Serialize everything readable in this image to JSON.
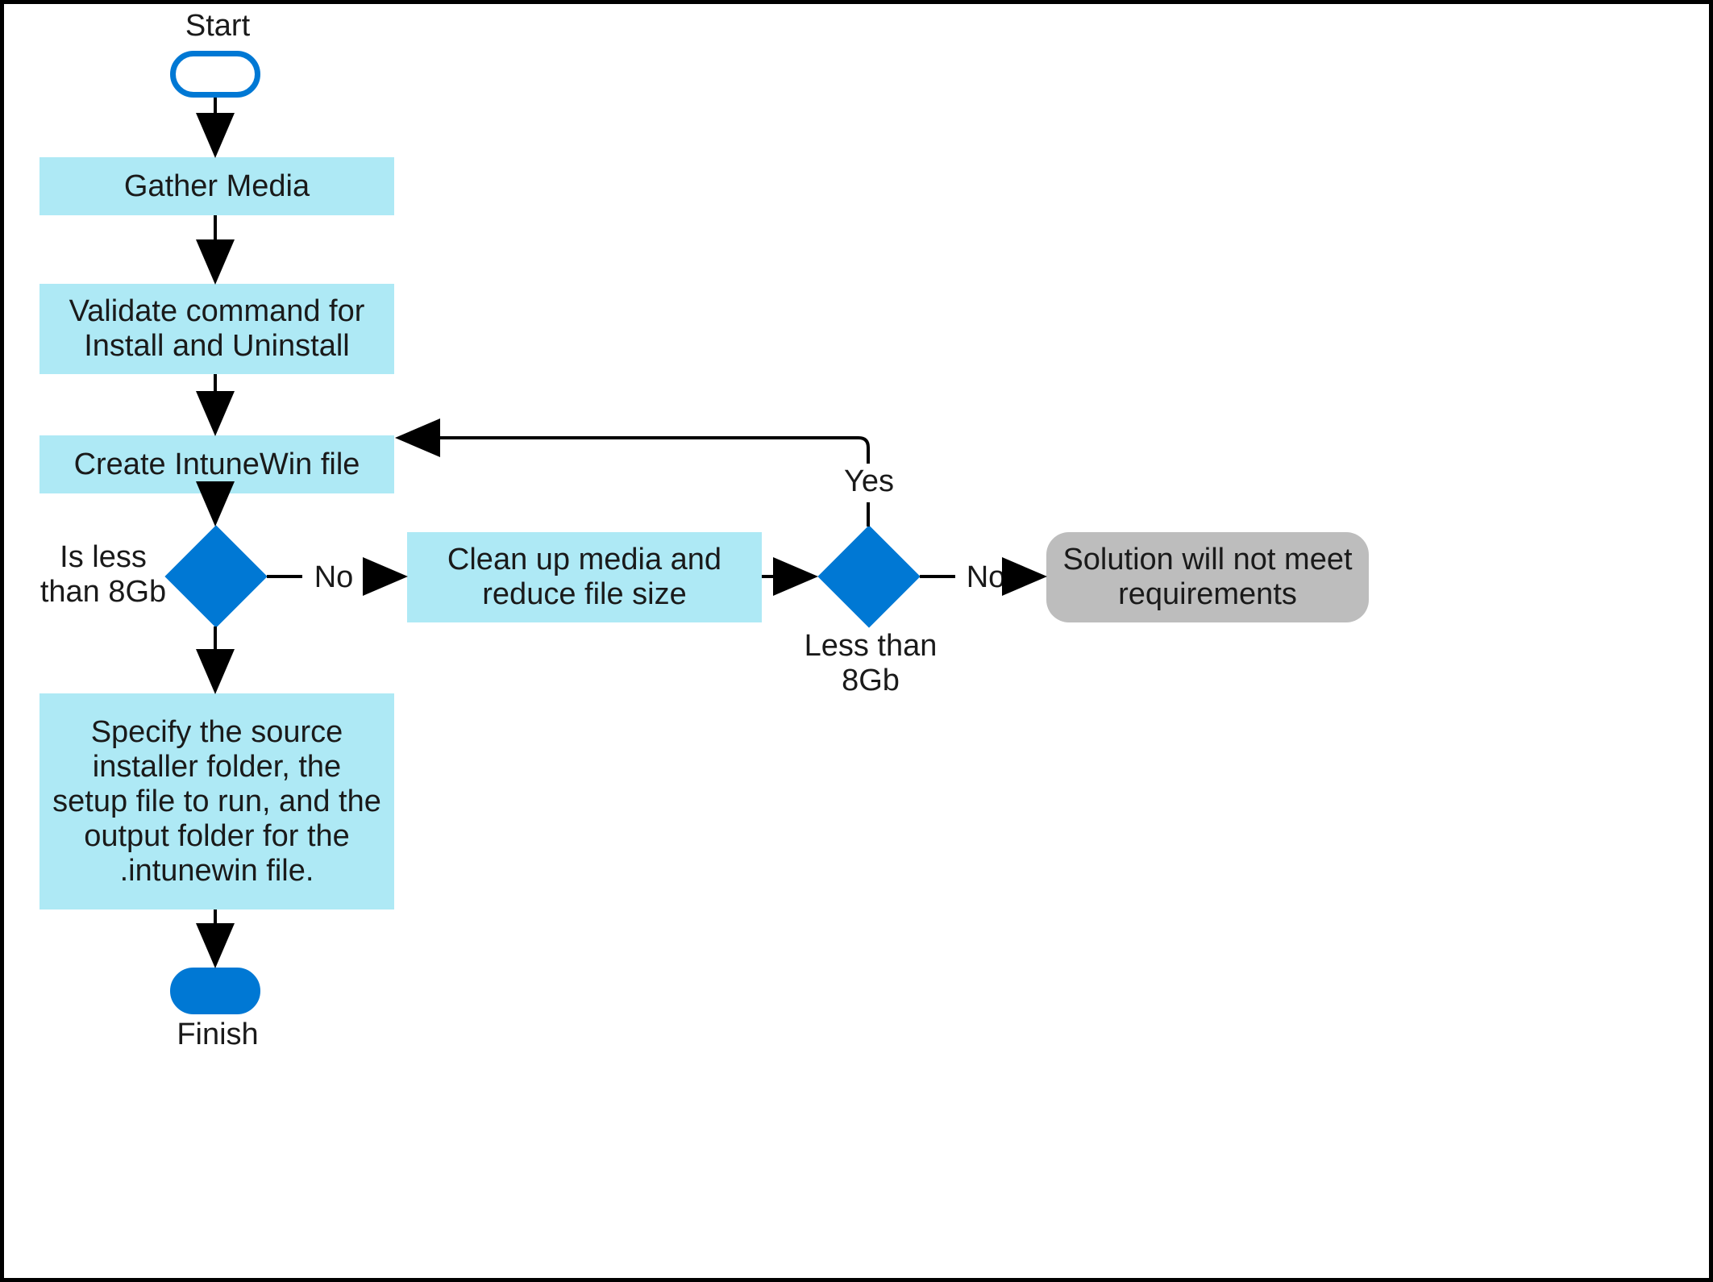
{
  "labels": {
    "start": "Start",
    "finish": "Finish",
    "yes": "Yes",
    "no1": "No",
    "no2": "No"
  },
  "nodes": {
    "gatherMedia": "Gather Media",
    "validate": "Validate command for Install and Uninstall",
    "createIntuneWin": "Create IntuneWin file",
    "cleanup": "Clean up media and reduce file size",
    "specify": "Specify the source installer folder, the setup file to run, and the output folder for the .intunewin file.",
    "solution": "Solution will not meet requirements",
    "decision1Label": "Is less than 8Gb",
    "decision2Label": "Less than 8Gb"
  }
}
